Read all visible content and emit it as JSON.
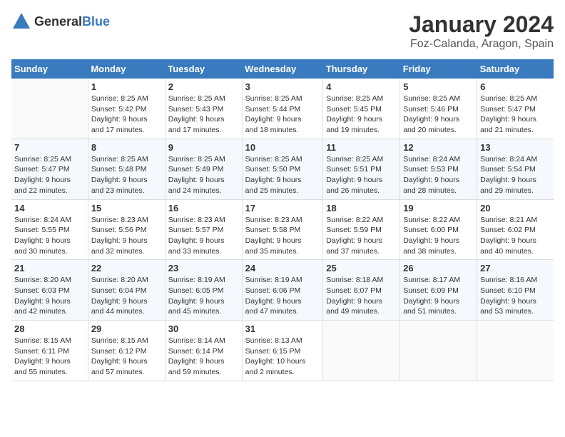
{
  "logo": {
    "general": "General",
    "blue": "Blue"
  },
  "title": "January 2024",
  "subtitle": "Foz-Calanda, Aragon, Spain",
  "days_of_week": [
    "Sunday",
    "Monday",
    "Tuesday",
    "Wednesday",
    "Thursday",
    "Friday",
    "Saturday"
  ],
  "weeks": [
    [
      {
        "day": "",
        "info": ""
      },
      {
        "day": "1",
        "info": "Sunrise: 8:25 AM\nSunset: 5:42 PM\nDaylight: 9 hours\nand 17 minutes."
      },
      {
        "day": "2",
        "info": "Sunrise: 8:25 AM\nSunset: 5:43 PM\nDaylight: 9 hours\nand 17 minutes."
      },
      {
        "day": "3",
        "info": "Sunrise: 8:25 AM\nSunset: 5:44 PM\nDaylight: 9 hours\nand 18 minutes."
      },
      {
        "day": "4",
        "info": "Sunrise: 8:25 AM\nSunset: 5:45 PM\nDaylight: 9 hours\nand 19 minutes."
      },
      {
        "day": "5",
        "info": "Sunrise: 8:25 AM\nSunset: 5:46 PM\nDaylight: 9 hours\nand 20 minutes."
      },
      {
        "day": "6",
        "info": "Sunrise: 8:25 AM\nSunset: 5:47 PM\nDaylight: 9 hours\nand 21 minutes."
      }
    ],
    [
      {
        "day": "7",
        "info": "Sunrise: 8:25 AM\nSunset: 5:47 PM\nDaylight: 9 hours\nand 22 minutes."
      },
      {
        "day": "8",
        "info": "Sunrise: 8:25 AM\nSunset: 5:48 PM\nDaylight: 9 hours\nand 23 minutes."
      },
      {
        "day": "9",
        "info": "Sunrise: 8:25 AM\nSunset: 5:49 PM\nDaylight: 9 hours\nand 24 minutes."
      },
      {
        "day": "10",
        "info": "Sunrise: 8:25 AM\nSunset: 5:50 PM\nDaylight: 9 hours\nand 25 minutes."
      },
      {
        "day": "11",
        "info": "Sunrise: 8:25 AM\nSunset: 5:51 PM\nDaylight: 9 hours\nand 26 minutes."
      },
      {
        "day": "12",
        "info": "Sunrise: 8:24 AM\nSunset: 5:53 PM\nDaylight: 9 hours\nand 28 minutes."
      },
      {
        "day": "13",
        "info": "Sunrise: 8:24 AM\nSunset: 5:54 PM\nDaylight: 9 hours\nand 29 minutes."
      }
    ],
    [
      {
        "day": "14",
        "info": "Sunrise: 8:24 AM\nSunset: 5:55 PM\nDaylight: 9 hours\nand 30 minutes."
      },
      {
        "day": "15",
        "info": "Sunrise: 8:23 AM\nSunset: 5:56 PM\nDaylight: 9 hours\nand 32 minutes."
      },
      {
        "day": "16",
        "info": "Sunrise: 8:23 AM\nSunset: 5:57 PM\nDaylight: 9 hours\nand 33 minutes."
      },
      {
        "day": "17",
        "info": "Sunrise: 8:23 AM\nSunset: 5:58 PM\nDaylight: 9 hours\nand 35 minutes."
      },
      {
        "day": "18",
        "info": "Sunrise: 8:22 AM\nSunset: 5:59 PM\nDaylight: 9 hours\nand 37 minutes."
      },
      {
        "day": "19",
        "info": "Sunrise: 8:22 AM\nSunset: 6:00 PM\nDaylight: 9 hours\nand 38 minutes."
      },
      {
        "day": "20",
        "info": "Sunrise: 8:21 AM\nSunset: 6:02 PM\nDaylight: 9 hours\nand 40 minutes."
      }
    ],
    [
      {
        "day": "21",
        "info": "Sunrise: 8:20 AM\nSunset: 6:03 PM\nDaylight: 9 hours\nand 42 minutes."
      },
      {
        "day": "22",
        "info": "Sunrise: 8:20 AM\nSunset: 6:04 PM\nDaylight: 9 hours\nand 44 minutes."
      },
      {
        "day": "23",
        "info": "Sunrise: 8:19 AM\nSunset: 6:05 PM\nDaylight: 9 hours\nand 45 minutes."
      },
      {
        "day": "24",
        "info": "Sunrise: 8:19 AM\nSunset: 6:06 PM\nDaylight: 9 hours\nand 47 minutes."
      },
      {
        "day": "25",
        "info": "Sunrise: 8:18 AM\nSunset: 6:07 PM\nDaylight: 9 hours\nand 49 minutes."
      },
      {
        "day": "26",
        "info": "Sunrise: 8:17 AM\nSunset: 6:09 PM\nDaylight: 9 hours\nand 51 minutes."
      },
      {
        "day": "27",
        "info": "Sunrise: 8:16 AM\nSunset: 6:10 PM\nDaylight: 9 hours\nand 53 minutes."
      }
    ],
    [
      {
        "day": "28",
        "info": "Sunrise: 8:15 AM\nSunset: 6:11 PM\nDaylight: 9 hours\nand 55 minutes."
      },
      {
        "day": "29",
        "info": "Sunrise: 8:15 AM\nSunset: 6:12 PM\nDaylight: 9 hours\nand 57 minutes."
      },
      {
        "day": "30",
        "info": "Sunrise: 8:14 AM\nSunset: 6:14 PM\nDaylight: 9 hours\nand 59 minutes."
      },
      {
        "day": "31",
        "info": "Sunrise: 8:13 AM\nSunset: 6:15 PM\nDaylight: 10 hours\nand 2 minutes."
      },
      {
        "day": "",
        "info": ""
      },
      {
        "day": "",
        "info": ""
      },
      {
        "day": "",
        "info": ""
      }
    ]
  ]
}
